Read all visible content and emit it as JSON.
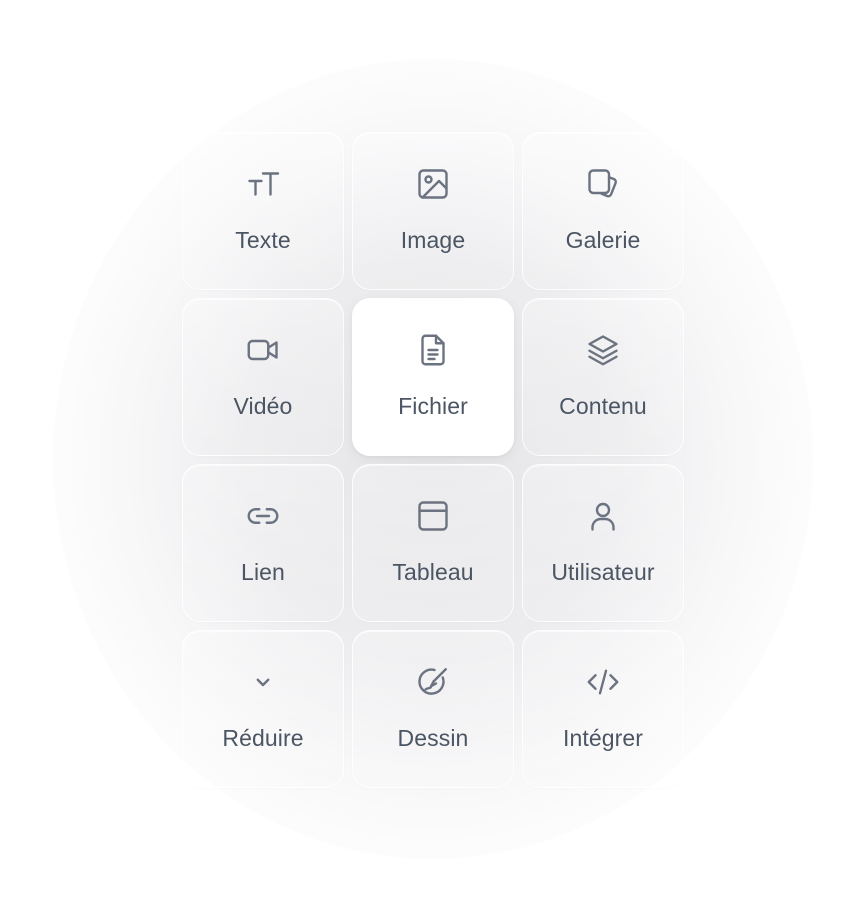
{
  "tiles": [
    {
      "label": "Texte",
      "icon": "text-size-icon"
    },
    {
      "label": "Image",
      "icon": "image-icon"
    },
    {
      "label": "Galerie",
      "icon": "gallery-icon"
    },
    {
      "label": "Vidéo",
      "icon": "video-icon"
    },
    {
      "label": "Fichier",
      "icon": "file-icon",
      "selected": true
    },
    {
      "label": "Contenu",
      "icon": "layers-icon"
    },
    {
      "label": "Lien",
      "icon": "link-icon"
    },
    {
      "label": "Tableau",
      "icon": "table-icon"
    },
    {
      "label": "Utilisateur",
      "icon": "user-icon"
    },
    {
      "label": "Réduire",
      "icon": "chevron-down-icon"
    },
    {
      "label": "Dessin",
      "icon": "drawing-icon"
    },
    {
      "label": "Intégrer",
      "icon": "code-icon"
    }
  ],
  "colors": {
    "icon": "#6b7280",
    "label": "#4b5563",
    "selected_tile": "#ffffff"
  }
}
